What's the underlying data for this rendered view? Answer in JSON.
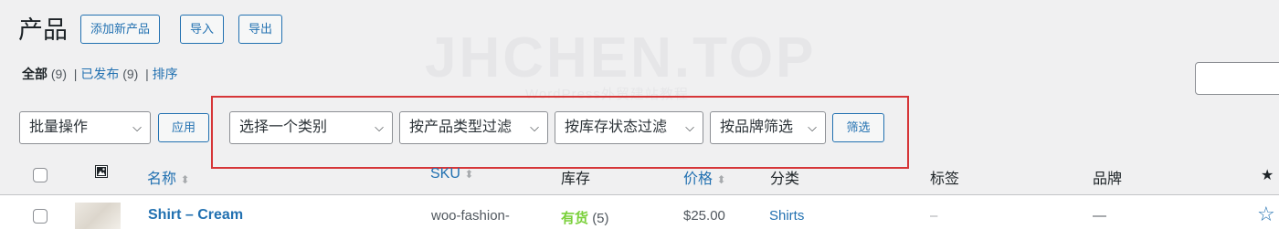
{
  "header": {
    "title": "产品",
    "buttons": {
      "add_new": "添加新产品",
      "import": "导入",
      "export": "导出"
    }
  },
  "watermark": {
    "main": "JHCHEN.TOP",
    "sub": "WordPress外贸建站教程"
  },
  "views": {
    "all_label": "全部",
    "all_count": "(9)",
    "sep1": "|",
    "published_label": "已发布",
    "published_count": "(9)",
    "sep2": "|",
    "sort_label": "排序"
  },
  "filters": {
    "bulk_actions": "批量操作",
    "apply": "应用",
    "category": "选择一个类别",
    "product_type": "按产品类型过滤",
    "stock_status": "按库存状态过滤",
    "brand": "按品牌筛选",
    "filter_button": "筛选"
  },
  "table": {
    "columns": {
      "name": "名称",
      "sku": "SKU",
      "stock": "库存",
      "price": "价格",
      "categories": "分类",
      "tags": "标签",
      "brand": "品牌",
      "featured": "★"
    },
    "rows": [
      {
        "name": "Shirt – Cream",
        "sku": "woo-fashion-",
        "stock_status": "有货",
        "stock_count": "(5)",
        "price": "$25.00",
        "category": "Shirts",
        "tags": "–",
        "brand": "—",
        "featured": "☆"
      }
    ]
  },
  "colors": {
    "link": "#2271b1",
    "in_stock": "#7ad03a",
    "highlight_box": "#d63638"
  }
}
